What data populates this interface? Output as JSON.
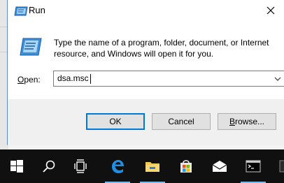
{
  "window": {
    "title": "Run",
    "close_icon": "close-icon",
    "title_icon": "run-icon"
  },
  "dialog": {
    "description": "Type the name of a program, folder, document, or Internet resource, and Windows will open it for you.",
    "open_label_accel": "O",
    "open_label_rest": "pen:",
    "open_value": "dsa.msc",
    "ok_label": "OK",
    "cancel_label": "Cancel",
    "browse_accel": "B",
    "browse_rest": "rowse..."
  },
  "taskbar": {
    "items": [
      {
        "icon": "windows-start-icon"
      },
      {
        "icon": "search-icon"
      },
      {
        "icon": "task-view-icon"
      },
      {
        "icon": "edge-icon"
      },
      {
        "icon": "file-explorer-icon"
      },
      {
        "icon": "store-icon"
      },
      {
        "icon": "mail-icon"
      },
      {
        "icon": "command-prompt-icon"
      }
    ]
  },
  "colors": {
    "accent": "#0078d7",
    "taskbar": "#101010",
    "footer": "#f0f0f0"
  }
}
